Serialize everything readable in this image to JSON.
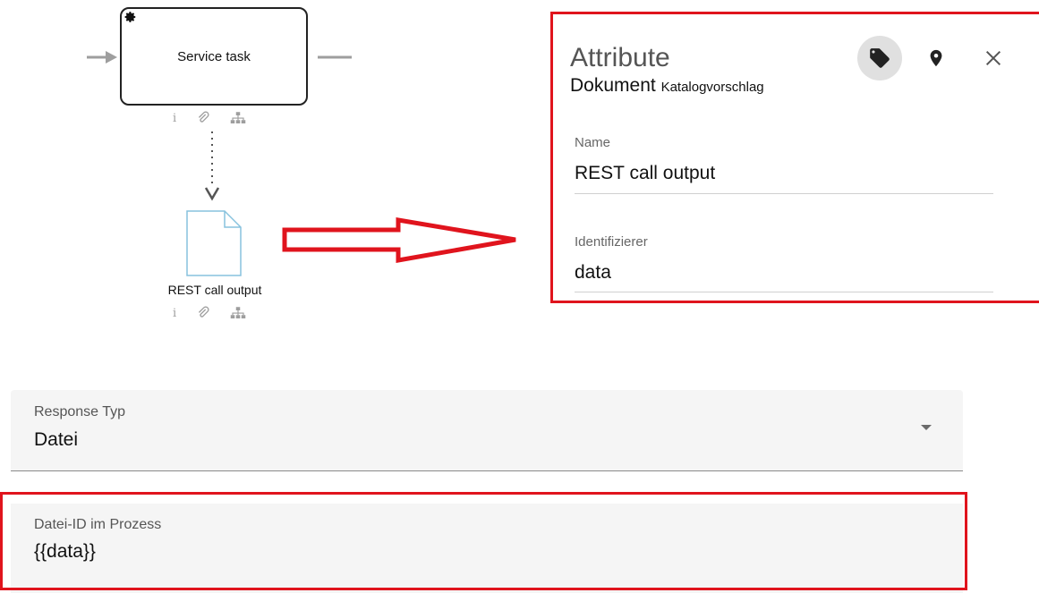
{
  "diagram": {
    "task_label": "Service task",
    "document_label": "REST call output",
    "info_glyph": "i"
  },
  "attributes_panel": {
    "title": "Attribute",
    "type": "Dokument",
    "subtype": "Katalogvorschlag",
    "fields": [
      {
        "label": "Name",
        "value": "REST call output"
      },
      {
        "label": "Identifizierer",
        "value": "data"
      }
    ]
  },
  "form": {
    "response_type": {
      "label": "Response Typ",
      "value": "Datei"
    },
    "file_id": {
      "label": "Datei-ID im Prozess",
      "value": "{{data}}"
    }
  },
  "colors": {
    "highlight_red": "#e0141d",
    "task_border": "#222222",
    "document_border": "#87c2dd",
    "field_background": "#f5f5f5",
    "tag_button_background": "#e0e0e0"
  },
  "icons": [
    "gear-icon",
    "info-icon",
    "paperclip-icon",
    "hierarchy-icon",
    "tag-icon",
    "location-pin-icon",
    "close-icon",
    "dropdown-caret-icon"
  ]
}
